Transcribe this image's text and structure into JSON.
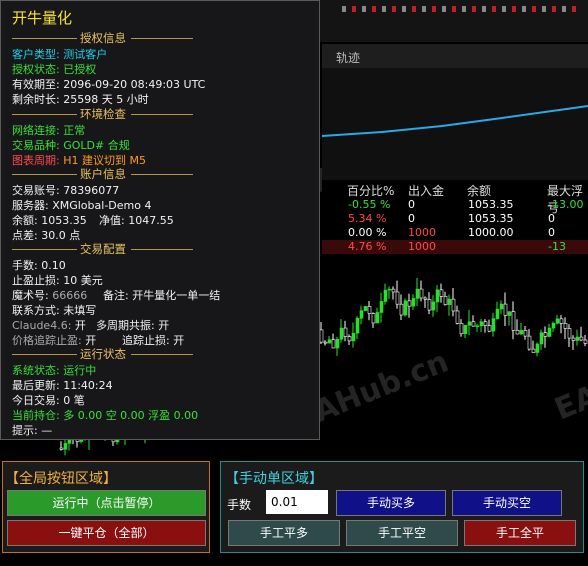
{
  "info": {
    "title": "开牛量化",
    "sections": {
      "auth": "授权信息",
      "env": "环境检查",
      "account": "账户信息",
      "config": "交易配置",
      "status": "运行状态"
    },
    "auth": {
      "customer_type": "客户类型: 测试客户",
      "auth_status": "授权状态: 已授权",
      "expiry": "有效期至: 2096-09-20 08:49:03 UTC",
      "remaining": "剩余时长: 25598 天 5 小时"
    },
    "env": {
      "network": "网络连接: 正常",
      "symbol": "交易品种: GOLD# 合规",
      "period_label": "图表周期: ",
      "period_value": "H1 建议切到 M5"
    },
    "account": {
      "account_no": "交易账号: 78396077",
      "server": "服务器: XMGlobal-Demo 4",
      "balance": "余额: 1053.35",
      "equity": "净值: 1047.55",
      "spread": "点差: 30.0 点"
    },
    "config": {
      "lots": "手数: 0.10",
      "tp_sl": "止盈止损: 10 美元",
      "magic_label": "魔术号: ",
      "magic_value": "66666",
      "remark": "备注: 开牛量化一单一结",
      "contact": "联系方式: 未填写",
      "claude_label": "Claude4.6: ",
      "claude_value": "开",
      "resonance": "多周期共振: 开",
      "trail_tp_label": "价格追踪止盈: ",
      "trail_tp_value": "开",
      "trail_sl": "追踪止损: 开"
    },
    "status": {
      "system": "系统状态: 运行中",
      "last_update": "最后更新: 11:40:24",
      "today_trades": "今日交易: 0 笔",
      "positions": "当前持仓: 多 0.00 空 0.00 浮盈 0.00",
      "hint": "提示: —"
    }
  },
  "track": {
    "label": "轨迹"
  },
  "stats": {
    "headers": [
      "百分比%",
      "出入金",
      "余额",
      "最大浮亏"
    ],
    "rows": [
      {
        "pct": "-0.55 %",
        "flow": "0",
        "balance": "1053.35",
        "maxdd": "-13.00",
        "pct_color": "#38e038",
        "flow_color": "#ffffff",
        "maxdd_color": "#38e038"
      },
      {
        "pct": "5.34 %",
        "flow": "0",
        "balance": "1053.35",
        "maxdd": "0",
        "pct_color": "#ff4a4a",
        "flow_color": "#ffffff",
        "maxdd_color": "#ffffff"
      },
      {
        "pct": "0.00 %",
        "flow": "1000",
        "balance": "1000.00",
        "maxdd": "0",
        "pct_color": "#ffffff",
        "flow_color": "#ff4a4a",
        "maxdd_color": "#ffffff"
      },
      {
        "pct": "4.76 %",
        "flow": "1000",
        "balance": "",
        "maxdd": "-13",
        "pct_color": "#ff4a4a",
        "flow_color": "#ff4a4a",
        "maxdd_color": "#38e038"
      }
    ]
  },
  "global_panel": {
    "title": "【全局按钮区域】",
    "run_button": "运行中（点击暂停）",
    "close_all_button": "一键平仓（全部）"
  },
  "manual_panel": {
    "title": "【手动单区域】",
    "lots_label": "手数",
    "lots_value": "0.01",
    "buy_button": "手动买多",
    "sell_button": "手动买空",
    "close_buy_button": "手工平多",
    "close_sell_button": "手工平空",
    "close_all_button": "手工全平"
  },
  "watermark": "EAHub.cn",
  "colors": {
    "bull": "#28e028",
    "bear": "#ffffff",
    "balance_line": "#2aa8e8",
    "accent_gold": "#e8c060"
  }
}
